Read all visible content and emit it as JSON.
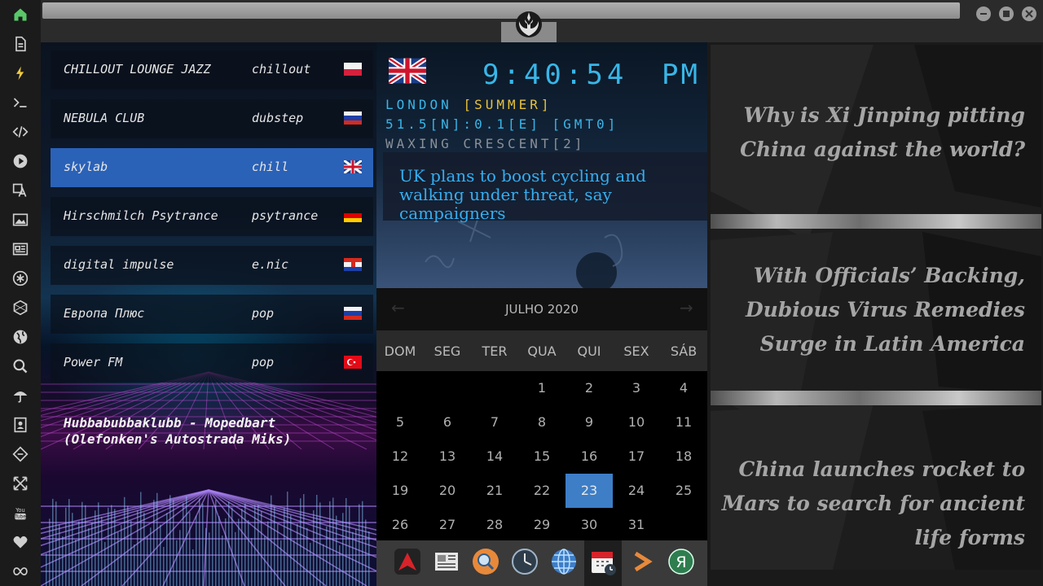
{
  "sidebar": {
    "icons": [
      "home-icon",
      "document-icon",
      "lightning-icon",
      "terminal-icon",
      "code-icon",
      "play-icon",
      "translate-icon",
      "image-icon",
      "newspaper-icon",
      "asterisk-icon",
      "hexagon-icon",
      "globe-icon",
      "search-icon",
      "umbrella-icon",
      "contact-icon",
      "tag-icon",
      "expand-icon",
      "youtube-icon",
      "heart-icon",
      "infinity-icon"
    ]
  },
  "radio": {
    "stations": [
      {
        "name": "CHILLOUT LOUNGE JAZZ",
        "genre": "chillout",
        "flag": "poland"
      },
      {
        "name": "NEBULA CLUB",
        "genre": "dubstep",
        "flag": "russia"
      },
      {
        "name": "skylab",
        "genre": "chill",
        "flag": "uk"
      },
      {
        "name": "Hirschmilch Psytrance",
        "genre": "psytrance",
        "flag": "germany"
      },
      {
        "name": "digital impulse",
        "genre": "e.nic",
        "flag": "croatia"
      },
      {
        "name": "Европа Плюс",
        "genre": "pop",
        "flag": "russia"
      },
      {
        "name": "Power FM",
        "genre": "pop",
        "flag": "turkey"
      }
    ],
    "now_playing": "Hubbabubbaklubb - Mopedbart (Olefonken's Autostrada Miks)"
  },
  "clock": {
    "time": "9:40:54",
    "ampm": "PM",
    "city": "LONDON",
    "season": "[SUMMER]",
    "coords": "51.5[N]:0.1[E] [GMT0]",
    "moon": "WAXING CRESCENT[2]",
    "news": "UK plans to boost cycling and walking under threat, say campaigners",
    "accent": "#38b6e8",
    "season_color": "#e8c23a"
  },
  "calendar": {
    "month": "JULHO 2020",
    "weekdays": [
      "DOM",
      "SEG",
      "TER",
      "QUA",
      "QUI",
      "SEX",
      "SÁB"
    ],
    "today": "23",
    "days": [
      [
        "",
        "",
        "",
        "1",
        "2",
        "3",
        "4"
      ],
      [
        "5",
        "6",
        "7",
        "8",
        "9",
        "10",
        "11"
      ],
      [
        "12",
        "13",
        "14",
        "15",
        "16",
        "17",
        "18"
      ],
      [
        "19",
        "20",
        "21",
        "22",
        "23",
        "24",
        "25"
      ],
      [
        "26",
        "27",
        "28",
        "29",
        "30",
        "31",
        ""
      ]
    ]
  },
  "dock": {
    "icons": [
      "arch-app-icon",
      "news-reader-icon",
      "search-app-icon",
      "clock-app-icon",
      "globe-app-icon",
      "calendar-app-icon",
      "terminal-app-icon",
      "yandex-icon"
    ]
  },
  "headlines": [
    "Why is Xi Jinping pitting China against the world?",
    "With Officials’ Backing, Dubious Virus Remedies Surge in Latin America",
    "China launches rocket to Mars to search for ancient life forms"
  ]
}
